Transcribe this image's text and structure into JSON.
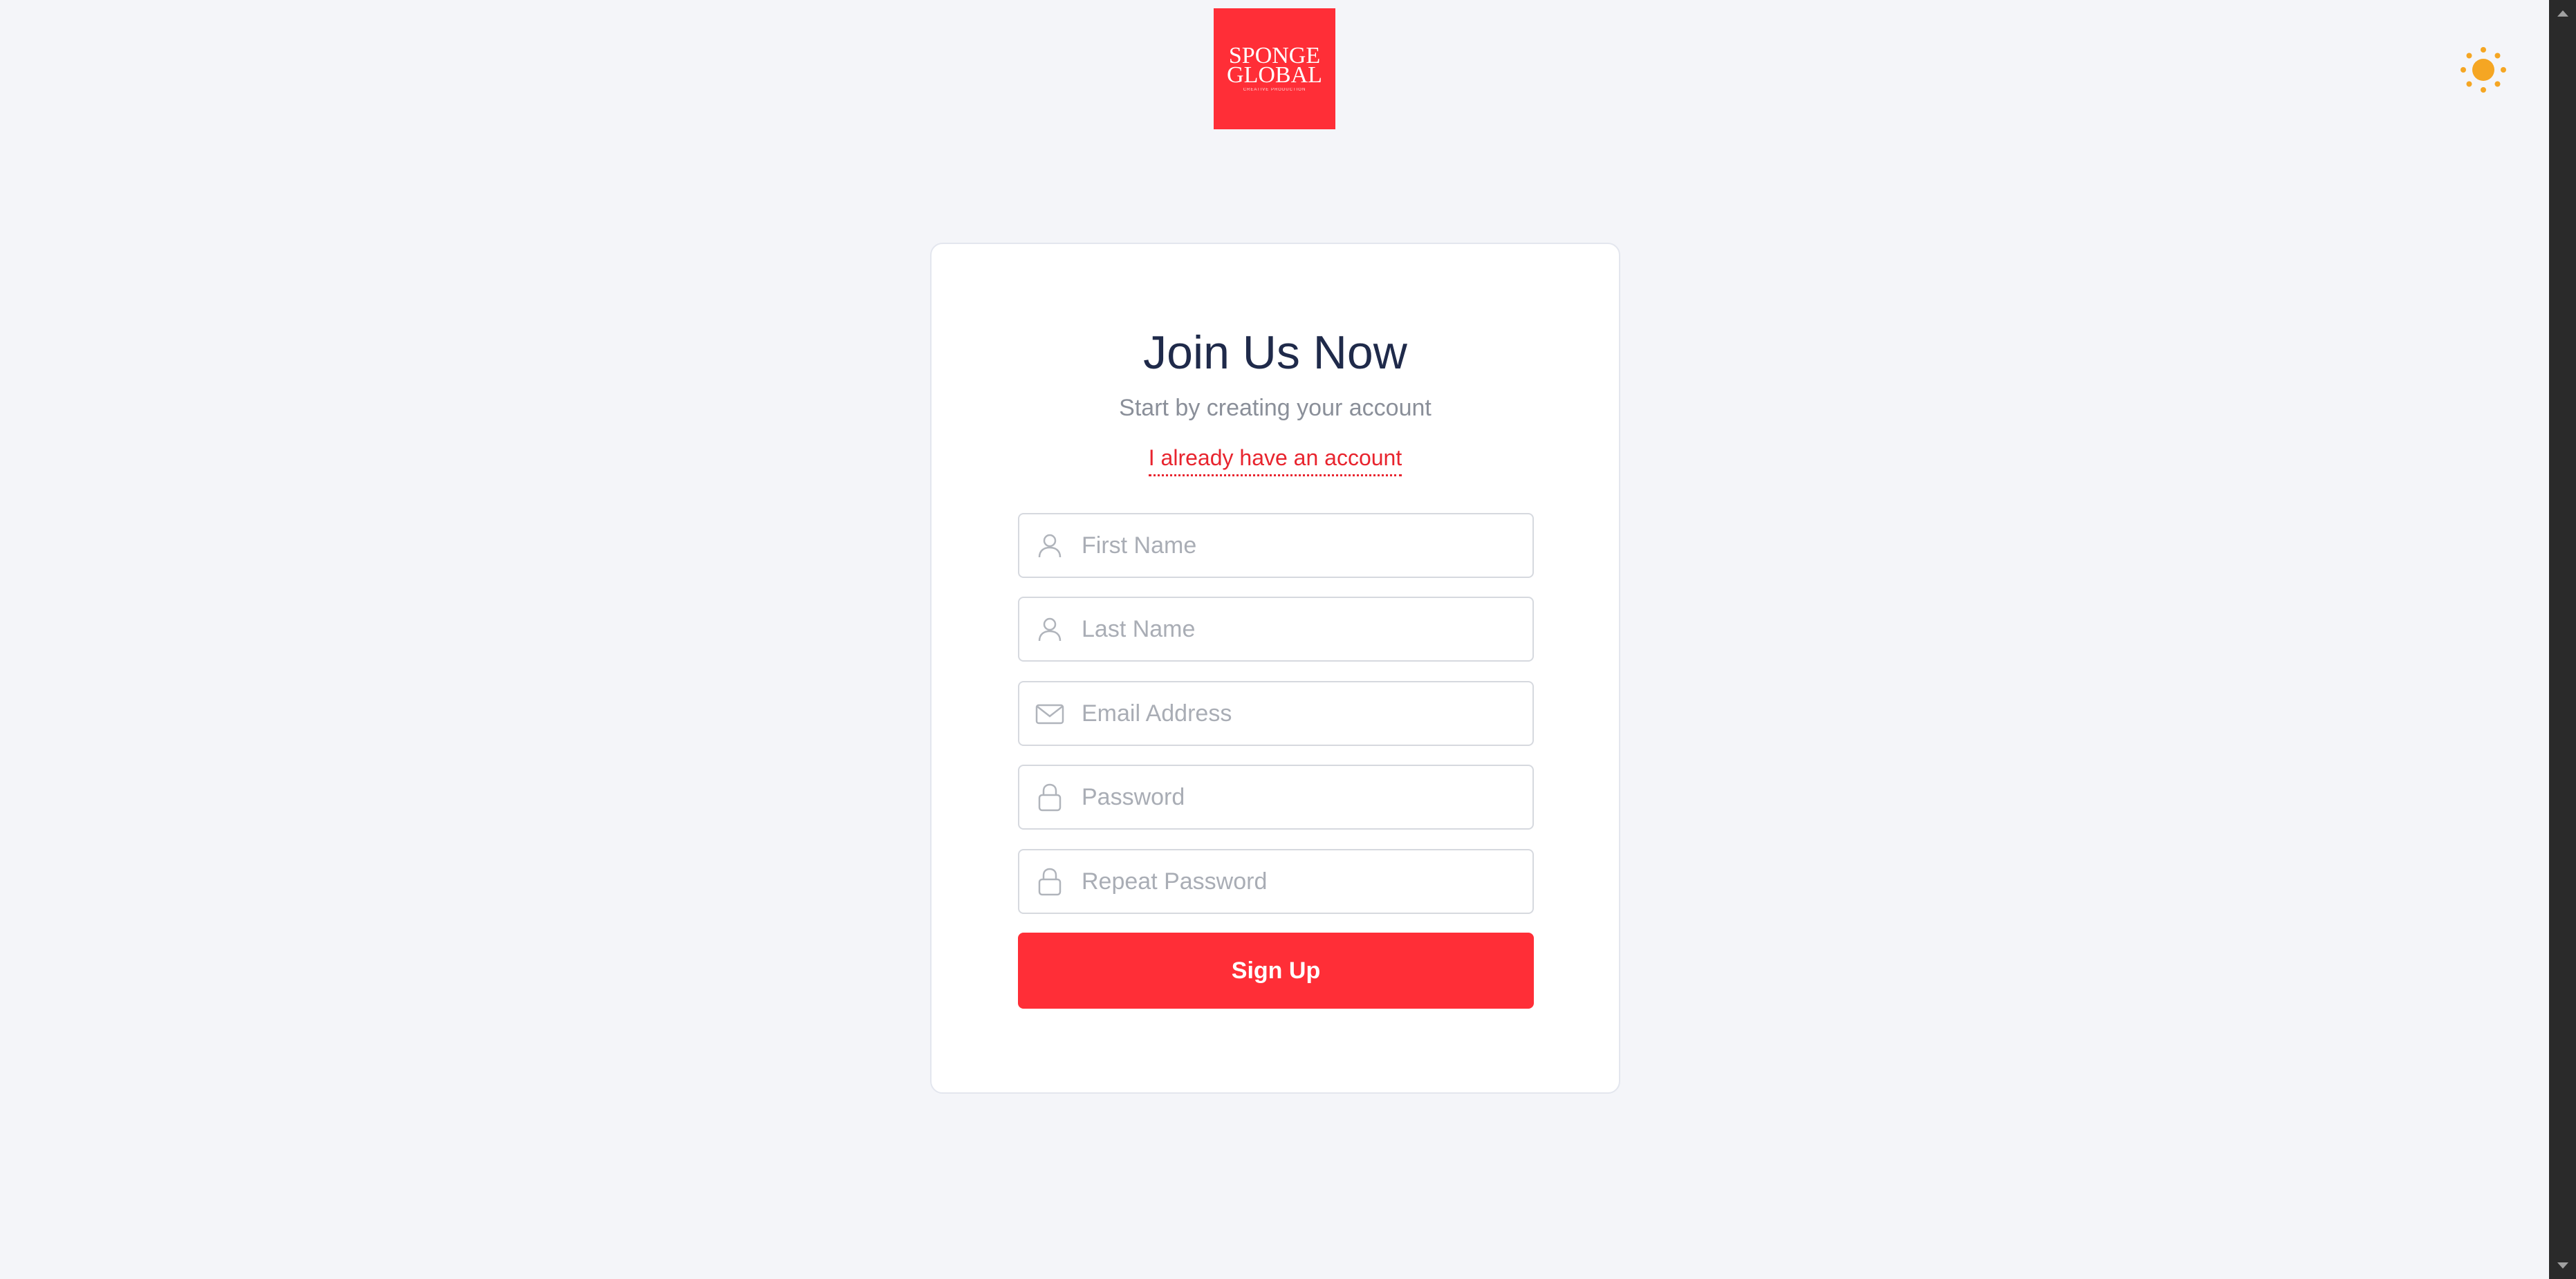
{
  "logo": {
    "line1": "SPONGE",
    "line2": "GLOBAL",
    "tagline": "CREATIVE PRODUCTION",
    "color": "#ff2e37"
  },
  "theme_toggle": {
    "icon": "sun-icon",
    "color": "#f5a623"
  },
  "card": {
    "title": "Join Us Now",
    "subtitle": "Start by creating your account",
    "login_link": "I already have an account"
  },
  "form": {
    "fields": [
      {
        "icon": "user-icon",
        "placeholder": "First Name",
        "value": ""
      },
      {
        "icon": "user-icon",
        "placeholder": "Last Name",
        "value": ""
      },
      {
        "icon": "mail-icon",
        "placeholder": "Email Address",
        "value": ""
      },
      {
        "icon": "lock-icon",
        "placeholder": "Password",
        "value": ""
      },
      {
        "icon": "lock-icon",
        "placeholder": "Repeat Password",
        "value": ""
      }
    ],
    "submit_label": "Sign Up",
    "accent_color": "#ff2e37"
  }
}
